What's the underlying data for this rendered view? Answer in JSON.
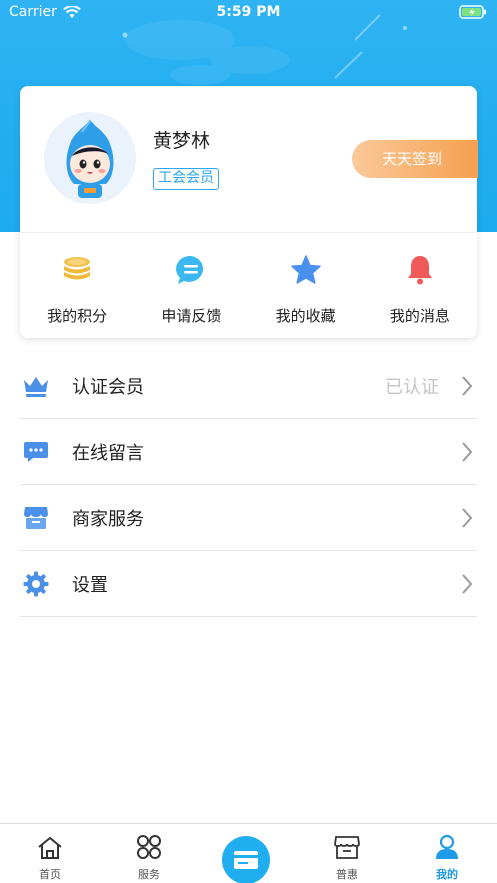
{
  "status_bar": {
    "carrier": "Carrier",
    "time": "5:59 PM"
  },
  "profile": {
    "name": "黄梦林",
    "badge": "工会会员",
    "signin_label": "天天签到"
  },
  "quick_actions": [
    {
      "label": "我的积分",
      "icon": "coins-icon",
      "color": "#f2c14e"
    },
    {
      "label": "申请反馈",
      "icon": "chat-bubble-icon",
      "color": "#3bb8f0"
    },
    {
      "label": "我的收藏",
      "icon": "star-icon",
      "color": "#4a90f0"
    },
    {
      "label": "我的消息",
      "icon": "bell-icon",
      "color": "#f05a5a"
    }
  ],
  "menu": [
    {
      "label": "认证会员",
      "value": "已认证",
      "icon": "crown-icon"
    },
    {
      "label": "在线留言",
      "value": "",
      "icon": "message-icon"
    },
    {
      "label": "商家服务",
      "value": "",
      "icon": "store-icon"
    },
    {
      "label": "设置",
      "value": "",
      "icon": "gear-icon"
    }
  ],
  "tab_bar": {
    "items": [
      {
        "label": "首页",
        "icon": "home-icon"
      },
      {
        "label": "服务",
        "icon": "grid-icon"
      },
      {
        "label": "",
        "icon": "card-icon"
      },
      {
        "label": "普惠",
        "icon": "shop-icon"
      },
      {
        "label": "我的",
        "icon": "person-icon",
        "active": true
      }
    ]
  },
  "colors": {
    "primary": "#21aef0",
    "accent_orange": "#f6a04f",
    "active_tab": "#1e9be8"
  }
}
